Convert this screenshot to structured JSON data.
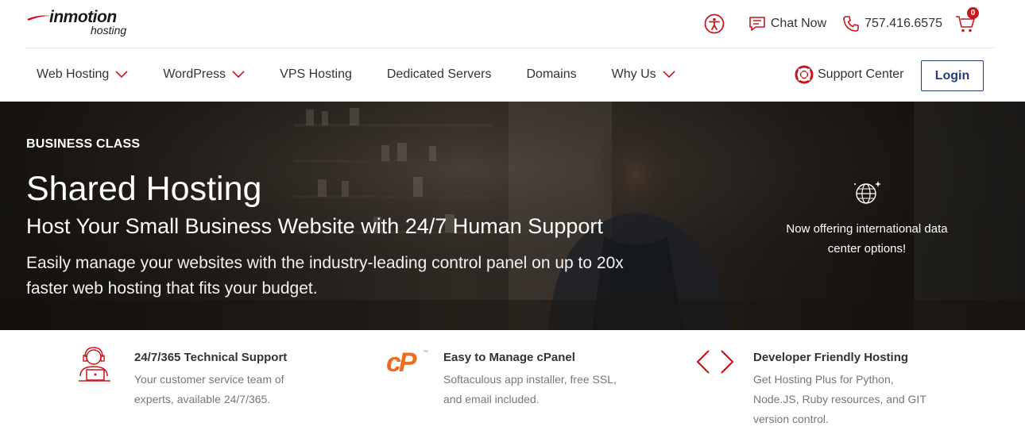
{
  "brand": {
    "logo_main": "inmotion",
    "logo_sub": "hosting",
    "accent": "#c8161d",
    "navy": "#1f3f7a"
  },
  "topbar": {
    "chat_label": "Chat Now",
    "phone": "757.416.6575",
    "cart_count": "0",
    "icons": [
      "accessibility-icon",
      "chat-icon",
      "phone-icon",
      "cart-icon"
    ]
  },
  "nav": {
    "items": [
      {
        "label": "Web Hosting",
        "dropdown": true
      },
      {
        "label": "WordPress",
        "dropdown": true
      },
      {
        "label": "VPS Hosting",
        "dropdown": false
      },
      {
        "label": "Dedicated Servers",
        "dropdown": false
      },
      {
        "label": "Domains",
        "dropdown": false
      },
      {
        "label": "Why Us",
        "dropdown": true
      }
    ],
    "support_label": "Support Center",
    "login_label": "Login"
  },
  "hero": {
    "eyebrow": "BUSINESS CLASS",
    "title": "Shared Hosting",
    "subtitle": "Host Your Small Business Website with 24/7 Human Support",
    "description": "Easily manage your websites with the industry-leading control panel on up to 20x faster web hosting that fits your budget.",
    "intl_line1": "Now offering international data",
    "intl_line2": "center options!"
  },
  "features": [
    {
      "icon": "support-agent-icon",
      "title": "24/7/365 Technical Support",
      "line1": "Your customer service team of",
      "line2": "experts, available 24/7/365.",
      "line3": ""
    },
    {
      "icon": "cpanel-icon",
      "title": "Easy to Manage cPanel",
      "line1": "Softaculous app installer, free SSL,",
      "line2": "and email included.",
      "line3": ""
    },
    {
      "icon": "code-brackets-icon",
      "title": "Developer Friendly Hosting",
      "line1": "Get Hosting Plus for Python,",
      "line2": "Node.JS, Ruby resources, and GIT",
      "line3": "version control."
    }
  ]
}
